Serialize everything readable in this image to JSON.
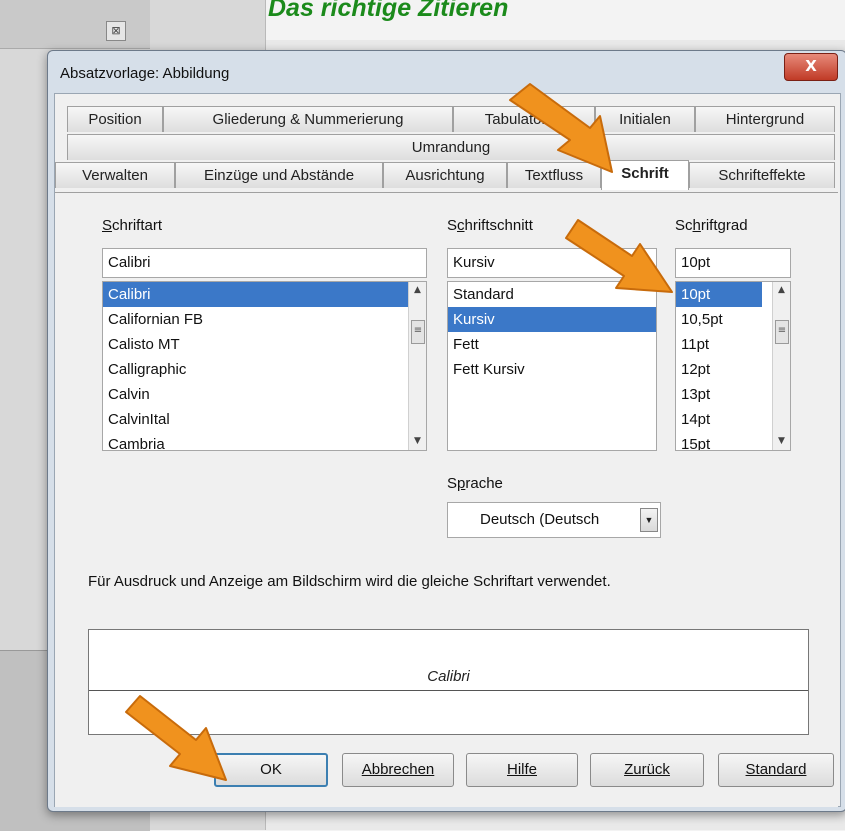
{
  "background": {
    "heading": "Das richtige Zitieren"
  },
  "dialog": {
    "title": "Absatzvorlage: Abbildung",
    "close_label": "X",
    "tabs_row1": [
      "Position",
      "Gliederung & Nummerierung",
      "Tabulatoren",
      "Initialen",
      "Hintergrund"
    ],
    "tabs_row2": [
      "Umrandung"
    ],
    "tabs_row3": [
      "Verwalten",
      "Einzüge und Abstände",
      "Ausrichtung",
      "Textfluss",
      "Schrift",
      "Schrifteffekte"
    ],
    "active_tab": "Schrift"
  },
  "font": {
    "label_a": "S",
    "label_b": "chriftart",
    "value": "Calibri",
    "items": [
      "Calibri",
      "Californian FB",
      "Calisto MT",
      "Calligraphic",
      "Calvin",
      "CalvinItal",
      "Cambria"
    ],
    "selected": "Calibri"
  },
  "style": {
    "label_a": "S",
    "label_b": "c",
    "label_c": "hriftschnitt",
    "value": "Kursiv",
    "items": [
      "Standard",
      "Kursiv",
      "Fett",
      "Fett Kursiv"
    ],
    "selected": "Kursiv"
  },
  "size": {
    "label_a": "Sc",
    "label_b": "h",
    "label_c": "riftgrad",
    "value": "10pt",
    "items": [
      "10pt",
      "10,5pt",
      "11pt",
      "12pt",
      "13pt",
      "14pt",
      "15pt"
    ],
    "selected": "10pt"
  },
  "language": {
    "label_a": "S",
    "label_b": "p",
    "label_c": "rache",
    "value": "Deutsch (Deutsch"
  },
  "info_text": "Für Ausdruck und Anzeige am Bildschirm wird die gleiche Schriftart verwendet.",
  "preview_text": "Calibri",
  "buttons": {
    "ok": "OK",
    "cancel": "Abbrechen",
    "help": "Hilfe",
    "back": "Zurück",
    "standard": "Standard"
  },
  "colors": {
    "selection": "#3b78c8",
    "arrow": "#f0921e",
    "heading": "#1b8a1b"
  }
}
